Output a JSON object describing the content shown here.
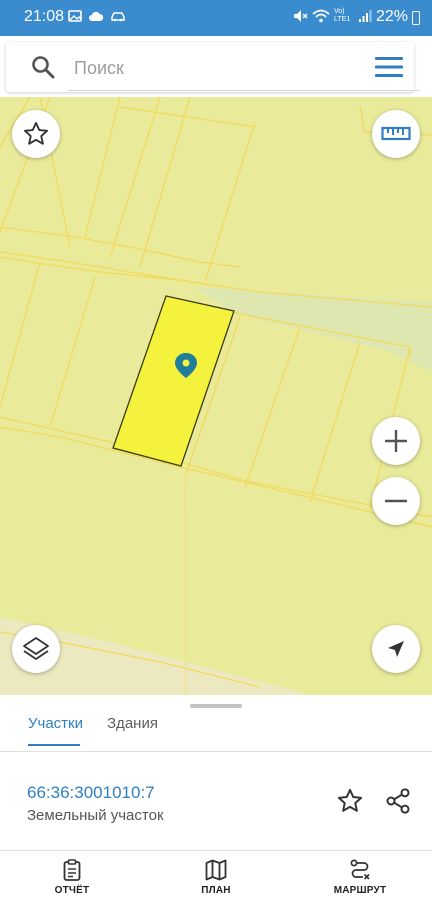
{
  "status_bar": {
    "time": "21:08",
    "network_label": "Vo) LTE1",
    "battery": "22%"
  },
  "search": {
    "placeholder": "Поиск",
    "value": ""
  },
  "map": {
    "base_color": "#e9eb9b",
    "selected_parcel_color": "#f4f23c",
    "marker_color": "#1f7f9a"
  },
  "sheet": {
    "tabs": [
      {
        "label": "Участки",
        "active": true
      },
      {
        "label": "Здания",
        "active": false
      }
    ],
    "parcel": {
      "cadastral_number": "66:36:3001010:7",
      "type": "Земельный участок"
    }
  },
  "bottom_nav": {
    "items": [
      {
        "label": "ОТЧЁТ",
        "icon": "clipboard-icon"
      },
      {
        "label": "ПЛАН",
        "icon": "map-icon"
      },
      {
        "label": "МАРШРУТ",
        "icon": "route-icon"
      }
    ]
  },
  "colors": {
    "accent": "#2f7fc1",
    "status_bar": "#3b8ccf"
  }
}
